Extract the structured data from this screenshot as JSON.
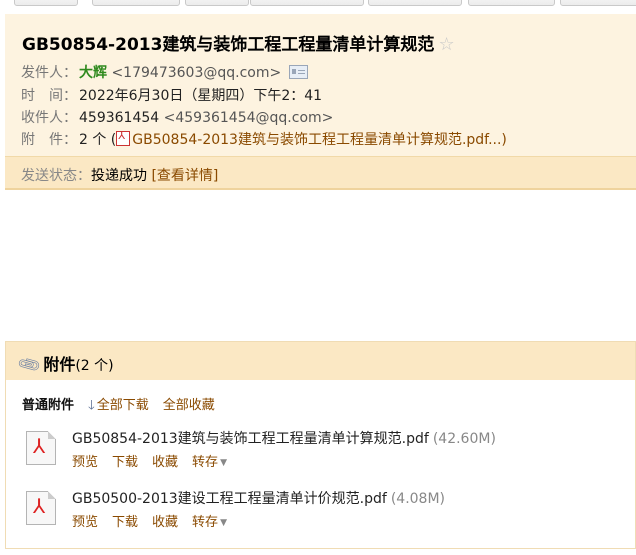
{
  "email": {
    "subject": "GB50854-2013建筑与装饰工程工程量清单计算规范",
    "star_icon": "star-icon",
    "sender": {
      "label": "发件人：",
      "name": "大辉",
      "address": "<179473603@qq.com>"
    },
    "time": {
      "label": "时　间：",
      "value": "2022年6月30日（星期四）下午2：41"
    },
    "recipient": {
      "label": "收件人：",
      "name": "459361454",
      "address": "<459361454@qq.com>"
    },
    "attachments_line": {
      "label": "附　件：",
      "count": "2 个 (",
      "file": "GB50854-2013建筑与装饰工程工程量清单计算规范.pdf...)"
    },
    "status": {
      "label": "发送状态：",
      "value": "投递成功",
      "detail_link": "[查看详情]"
    }
  },
  "attachments": {
    "title": "附件",
    "count": "(2 个)",
    "section_label": "普通附件",
    "download_all": "全部下载",
    "collect_all": "全部收藏",
    "files": [
      {
        "name": "GB50854-2013建筑与装饰工程工程量清单计算规范.pdf",
        "size": "(42.60M)",
        "actions": {
          "preview": "预览",
          "download": "下载",
          "collect": "收藏",
          "transfer": "转存"
        }
      },
      {
        "name": "GB50500-2013建设工程工程量清单计价规范.pdf",
        "size": "(4.08M)",
        "actions": {
          "preview": "预览",
          "download": "下载",
          "collect": "收藏",
          "transfer": "转存"
        }
      }
    ]
  },
  "colors": {
    "header_bg": "#fdf3e0",
    "status_bg": "#fbe8c4",
    "link": "#8a4a00",
    "sender_green": "#2f8a1e"
  }
}
